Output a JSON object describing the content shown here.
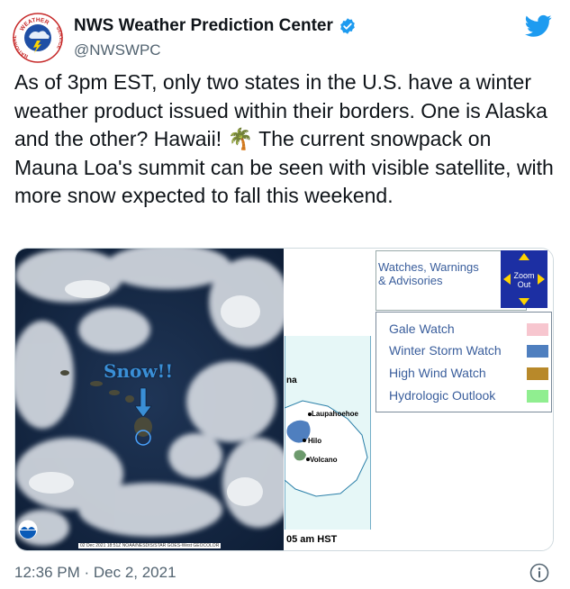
{
  "account": {
    "name": "NWS Weather Prediction Center",
    "handle": "@NWSWPC",
    "avatar_top_text": "WEATHER",
    "avatar_left_text": "NATIONAL",
    "avatar_right_text": "SERVICE"
  },
  "tweet": {
    "text": "As of 3pm EST, only two states in the U.S. have a winter weather product issued within their borders. One is Alaska and the other? Hawaii! 🌴 The current snowpack on Mauna Loa's summit can be seen with visible satellite, with more snow expected to fall this weekend.",
    "timestamp": "12:36 PM · Dec 2, 2021"
  },
  "satellite": {
    "annotation": "Snow!!",
    "credit": "02 Dec 2021 18:51Z NOAA/NESDIS/STAR GOES-West GEOCOLOR"
  },
  "map": {
    "legend_title": "Watches, Warnings & Advisories",
    "zoom_label_1": "Zoom",
    "zoom_label_2": "Out",
    "legend_items": [
      {
        "label": "Gale Watch",
        "color": "#f7c6cf"
      },
      {
        "label": "Winter Storm Watch",
        "color": "#4f7fbf"
      },
      {
        "label": "High Wind Watch",
        "color": "#b8892a"
      },
      {
        "label": "Hydrologic Outlook",
        "color": "#90ee90"
      }
    ],
    "places": [
      "na",
      "Laupahoehoe",
      "Hilo",
      "Volcano"
    ],
    "time_fragment": "05 am HST"
  },
  "colors": {
    "accent": "#1d9bf0",
    "text": "#0f1419",
    "muted": "#536471"
  }
}
